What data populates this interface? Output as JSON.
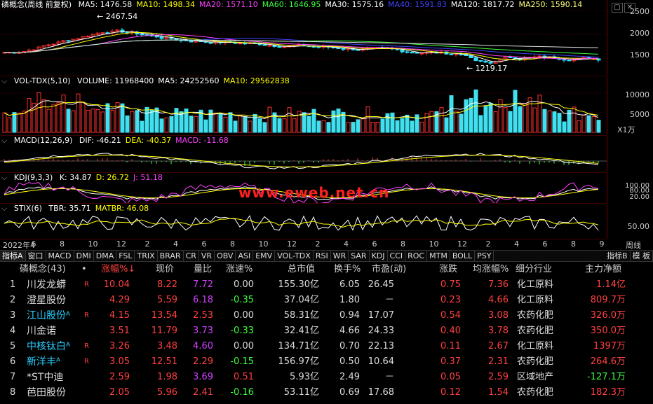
{
  "main": {
    "title": "磷概念(周线 前复权)",
    "ma": [
      {
        "label": "MA5: 1476.58",
        "color": "#ffffff"
      },
      {
        "label": "MA10: 1498.34",
        "color": "#ffff00"
      },
      {
        "label": "MA20: 1571.10",
        "color": "#ff40ff"
      },
      {
        "label": "MA60: 1646.95",
        "color": "#40ff40"
      },
      {
        "label": "MA30: 1575.16",
        "color": "#ffffff"
      },
      {
        "label": "MA40: 1591.83",
        "color": "#4040ff"
      },
      {
        "label": "MA120: 1817.72",
        "color": "#ffffff"
      },
      {
        "label": "MA250: 1590.14",
        "color": "#ffff80"
      }
    ],
    "high_label": "2467.54",
    "low_label": "1219.17",
    "y_ticks": [
      "2500",
      "2000",
      "1500"
    ]
  },
  "volume": {
    "title": "VOL-TDX(5,10)",
    "vals": [
      {
        "label": "VOLUME: 11968400",
        "color": "#ffffff"
      },
      {
        "label": "MA5: 24252560",
        "color": "#ffffff"
      },
      {
        "label": "MA10: 29562838",
        "color": "#ffff00"
      }
    ],
    "y_ticks": [
      "10000",
      "5000"
    ],
    "unit": "X1万"
  },
  "macd": {
    "title": "MACD(12,26,9)",
    "vals": [
      {
        "label": "DIF: -46.21",
        "color": "#ffffff"
      },
      {
        "label": "DEA: -40.37",
        "color": "#ffff00"
      },
      {
        "label": "MACD: -11.68",
        "color": "#ff40ff"
      }
    ]
  },
  "kdj": {
    "title": "KDJ(9,3,3)",
    "vals": [
      {
        "label": "K: 34.87",
        "color": "#ffffff"
      },
      {
        "label": "D: 26.72",
        "color": "#ffff00"
      },
      {
        "label": "J: 51.18",
        "color": "#ff40ff"
      }
    ],
    "y_ticks": [
      "100.00",
      "80.00",
      "20.00"
    ],
    "watermark": "www.eweb.net.cn"
  },
  "stix": {
    "title": "STIX(6)",
    "vals": [
      {
        "label": "TBR: 35.71",
        "color": "#ffffff"
      },
      {
        "label": "MATBR: 46.08",
        "color": "#ffff00"
      }
    ],
    "y_ticks": [
      "50.00"
    ]
  },
  "time_axis": [
    "2022年4",
    "6",
    "8",
    "10",
    "12",
    "2",
    "4",
    "6",
    "8",
    "10",
    "12",
    "2",
    "4",
    "6",
    "8",
    "10",
    "12",
    "2",
    "4",
    "6",
    "8",
    "9"
  ],
  "period": "周线",
  "tabs": [
    "指标A",
    "窗口",
    "MACD",
    "DMI",
    "DMA",
    "FSL",
    "TRIX",
    "BRAR",
    "CR",
    "VR",
    "OBV",
    "ASI",
    "EMV",
    "VOL-TDX",
    "RSI",
    "WR",
    "SAR",
    "KDJ",
    "CCI",
    "ROC",
    "MTM",
    "BOLL",
    "PSY"
  ],
  "tabs_right": [
    "指标B",
    "模 板"
  ],
  "table": {
    "headers": [
      "磷概念(43)",
      "•",
      "涨幅%↓",
      "现价",
      "量比",
      "涨速%",
      "总市值",
      "换手%",
      "市盈(动)",
      "涨跌",
      "均涨幅%",
      "细分行业",
      "主力净额"
    ],
    "rows": [
      {
        "no": "1",
        "name": "川发龙蟒",
        "nc": "white",
        "mark": "R",
        "chg": "10.04",
        "price": "8.22",
        "vr": "7.72",
        "vrc": "purple",
        "spd": "0.00",
        "spdc": "white",
        "cap": "155.30亿",
        "turn": "6.05",
        "pe": "26.45",
        "diff": "0.75",
        "avg": "7.36",
        "ind": "化工原料",
        "net": "1.14亿",
        "netc": "red"
      },
      {
        "no": "2",
        "name": "澄星股份",
        "nc": "white",
        "mark": "",
        "chg": "4.29",
        "price": "5.59",
        "vr": "6.18",
        "vrc": "purple",
        "spd": "-0.35",
        "spdc": "green",
        "cap": "37.04亿",
        "turn": "1.80",
        "pe": "－",
        "diff": "0.23",
        "avg": "4.66",
        "ind": "化工原料",
        "net": "809.7万",
        "netc": "red"
      },
      {
        "no": "3",
        "name": "江山股份ᴬ",
        "nc": "cyan",
        "mark": "R",
        "chg": "4.15",
        "price": "13.54",
        "vr": "2.53",
        "vrc": "red",
        "spd": "0.00",
        "spdc": "white",
        "cap": "58.31亿",
        "turn": "0.94",
        "pe": "17.07",
        "diff": "0.54",
        "avg": "3.08",
        "ind": "农药化肥",
        "net": "326.0万",
        "netc": "red"
      },
      {
        "no": "4",
        "name": "川金诺",
        "nc": "white",
        "mark": "",
        "chg": "3.51",
        "price": "11.79",
        "vr": "3.73",
        "vrc": "purple",
        "spd": "-0.33",
        "spdc": "green",
        "cap": "32.41亿",
        "turn": "4.66",
        "pe": "24.33",
        "diff": "0.40",
        "avg": "3.78",
        "ind": "农药化肥",
        "net": "350.0万",
        "netc": "red"
      },
      {
        "no": "5",
        "name": "中核钛白ᴬ",
        "nc": "cyan",
        "mark": "R",
        "chg": "3.26",
        "price": "3.48",
        "vr": "4.60",
        "vrc": "purple",
        "spd": "0.00",
        "spdc": "white",
        "cap": "134.71亿",
        "turn": "0.70",
        "pe": "22.13",
        "diff": "0.11",
        "avg": "2.67",
        "ind": "化工原料",
        "net": "1397万",
        "netc": "red"
      },
      {
        "no": "6",
        "name": "新洋丰ᴬ",
        "nc": "cyan",
        "mark": "R",
        "chg": "3.05",
        "price": "12.51",
        "vr": "2.29",
        "vrc": "red",
        "spd": "-0.15",
        "spdc": "green",
        "cap": "156.97亿",
        "turn": "0.50",
        "pe": "10.64",
        "diff": "0.37",
        "avg": "2.31",
        "ind": "农药化肥",
        "net": "264.6万",
        "netc": "red"
      },
      {
        "no": "7",
        "name": "*ST中迪",
        "nc": "white",
        "mark": "",
        "chg": "2.59",
        "price": "1.98",
        "vr": "3.69",
        "vrc": "purple",
        "spd": "0.51",
        "spdc": "red",
        "cap": "5.93亿",
        "turn": "2.49",
        "pe": "－",
        "diff": "0.05",
        "avg": "2.59",
        "ind": "区域地产",
        "net": "-127.1万",
        "netc": "green"
      },
      {
        "no": "8",
        "name": "芭田股份",
        "nc": "white",
        "mark": "",
        "chg": "2.05",
        "price": "5.96",
        "vr": "2.41",
        "vrc": "red",
        "spd": "-0.16",
        "spdc": "green",
        "cap": "53.11亿",
        "turn": "0.69",
        "pe": "17.68",
        "diff": "0.12",
        "avg": "1.54",
        "ind": "农药化肥",
        "net": "182.3万",
        "netc": "red"
      }
    ]
  }
}
